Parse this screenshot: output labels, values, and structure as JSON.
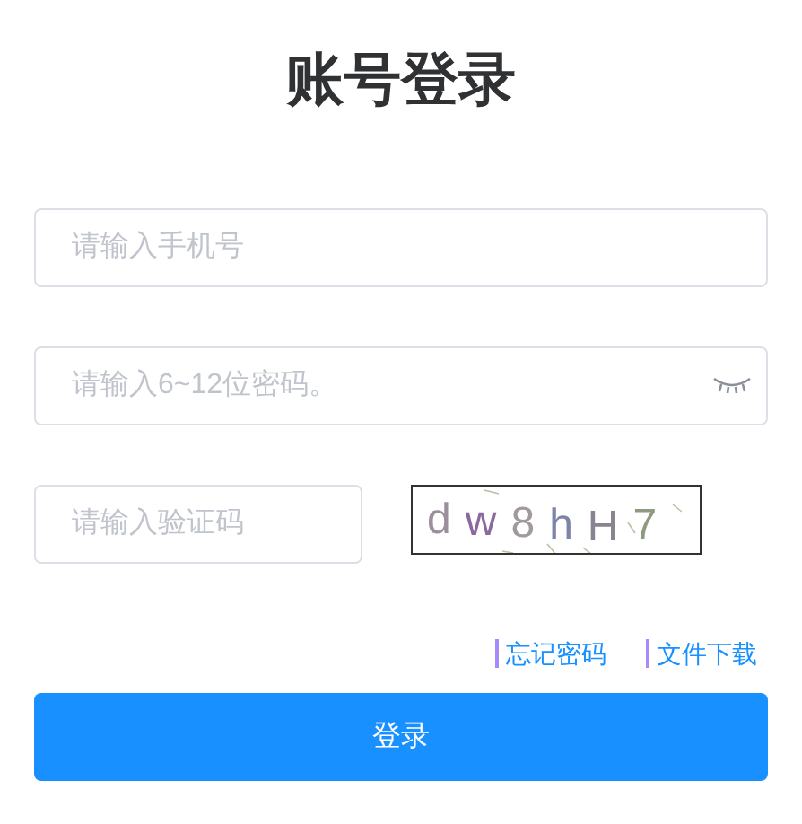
{
  "title": "账号登录",
  "phone_field": {
    "placeholder": "请输入手机号"
  },
  "password_field": {
    "placeholder": "请输入6~12位密码。",
    "password_visible": false
  },
  "captcha_field": {
    "placeholder": "请输入验证码"
  },
  "captcha": [
    {
      "char": "d",
      "color": "#9a8f9a"
    },
    {
      "char": "w",
      "color": "#8a6a9e"
    },
    {
      "char": "8",
      "color": "#a09a9a"
    },
    {
      "char": "h",
      "color": "#7e84a8"
    },
    {
      "char": "H",
      "color": "#8a8490"
    },
    {
      "char": "7",
      "color": "#8d9a7e"
    }
  ],
  "links": [
    "忘记密码",
    "文件下载"
  ],
  "login_button": "登录"
}
